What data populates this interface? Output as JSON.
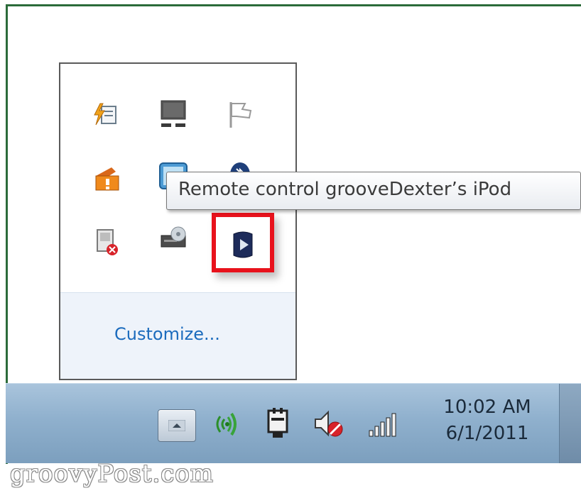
{
  "tray_popup": {
    "icons": [
      {
        "name": "action-center-alert-icon"
      },
      {
        "name": "network-computer-icon"
      },
      {
        "name": "flag-icon"
      },
      {
        "name": "warning-tool-icon"
      },
      {
        "name": "display-icon"
      },
      {
        "name": "bluetooth-icon"
      },
      {
        "name": "device-error-icon"
      },
      {
        "name": "disk-drive-icon"
      },
      {
        "name": "remote-play-icon"
      }
    ],
    "customize_label": "Customize..."
  },
  "tooltip": {
    "text": "Remote control grooveDexter’s iPod"
  },
  "taskbar": {
    "tray_icons": [
      "show-hidden-icons-icon",
      "wireless-signal-icon",
      "power-plug-icon",
      "volume-muted-icon",
      "network-bars-icon"
    ],
    "clock": {
      "time": "10:02 AM",
      "date": "6/1/2011"
    }
  },
  "watermark": "groovyPost.com",
  "colors": {
    "highlight": "#e8121c",
    "link": "#1b6bbd",
    "taskbar": "#8fb0cd"
  }
}
